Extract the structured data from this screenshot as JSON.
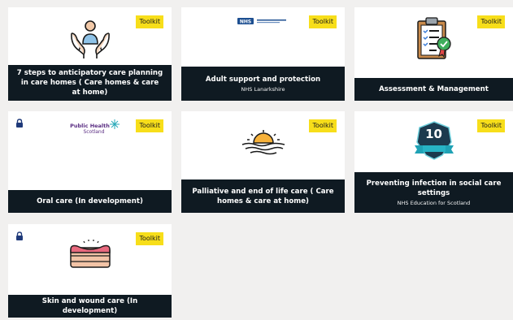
{
  "badge_label": "Toolkit",
  "colors": {
    "badge": "#f7de1a",
    "caption_bg": "#0f1a22",
    "page_bg": "#f1f0ef",
    "card_bg": "#ffffff"
  },
  "cards": [
    {
      "title": "7 steps to anticipatory care planning in care homes ( Care homes & care at home)",
      "subtitle": "",
      "icon": "hands-person-icon",
      "locked": false
    },
    {
      "title": "Adult support and protection",
      "subtitle": "NHS Lanarkshire",
      "icon": "nhs-logo",
      "locked": false
    },
    {
      "title": "Assessment & Management",
      "subtitle": "",
      "icon": "clipboard-checklist-icon",
      "locked": false
    },
    {
      "title": "Oral care (In development)",
      "subtitle": "",
      "icon": "public-health-scotland-logo",
      "locked": true,
      "logo_text_1": "Public Health",
      "logo_text_2": "Scotland"
    },
    {
      "title": "Palliative and end of life care ( Care homes & care at home)",
      "subtitle": "",
      "icon": "sunset-icon",
      "locked": false
    },
    {
      "title": "Preventing infection in social care settings",
      "subtitle": "NHS Education for Scotland",
      "icon": "ten-badge-icon",
      "locked": false,
      "badge_number": "10"
    },
    {
      "title": "Skin and wound care (In development)",
      "subtitle": "",
      "icon": "skin-layers-icon",
      "locked": true
    }
  ]
}
